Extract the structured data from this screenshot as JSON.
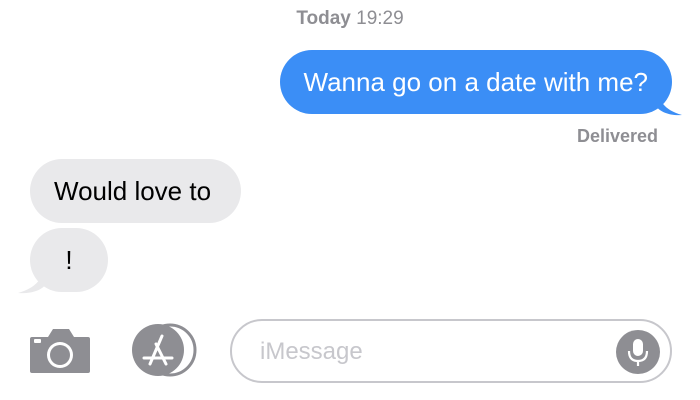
{
  "header": {
    "day": "Today",
    "time": "19:29"
  },
  "messages": [
    {
      "direction": "sent",
      "text": "Wanna go on a date with me?"
    },
    {
      "direction": "received",
      "text": "Would love to"
    },
    {
      "direction": "received",
      "text": "!"
    }
  ],
  "status": {
    "delivered": "Delivered"
  },
  "composer": {
    "placeholder": "iMessage",
    "camera_icon": "camera-icon",
    "appstore_icon": "app-store-icon",
    "mic_icon": "microphone-icon"
  },
  "colors": {
    "sent_bubble": "#3b8ef6",
    "received_bubble": "#e9e9eb",
    "secondary_text": "#8e8e93",
    "icon_gray": "#8e8e93",
    "input_border": "#c7c7cc"
  }
}
